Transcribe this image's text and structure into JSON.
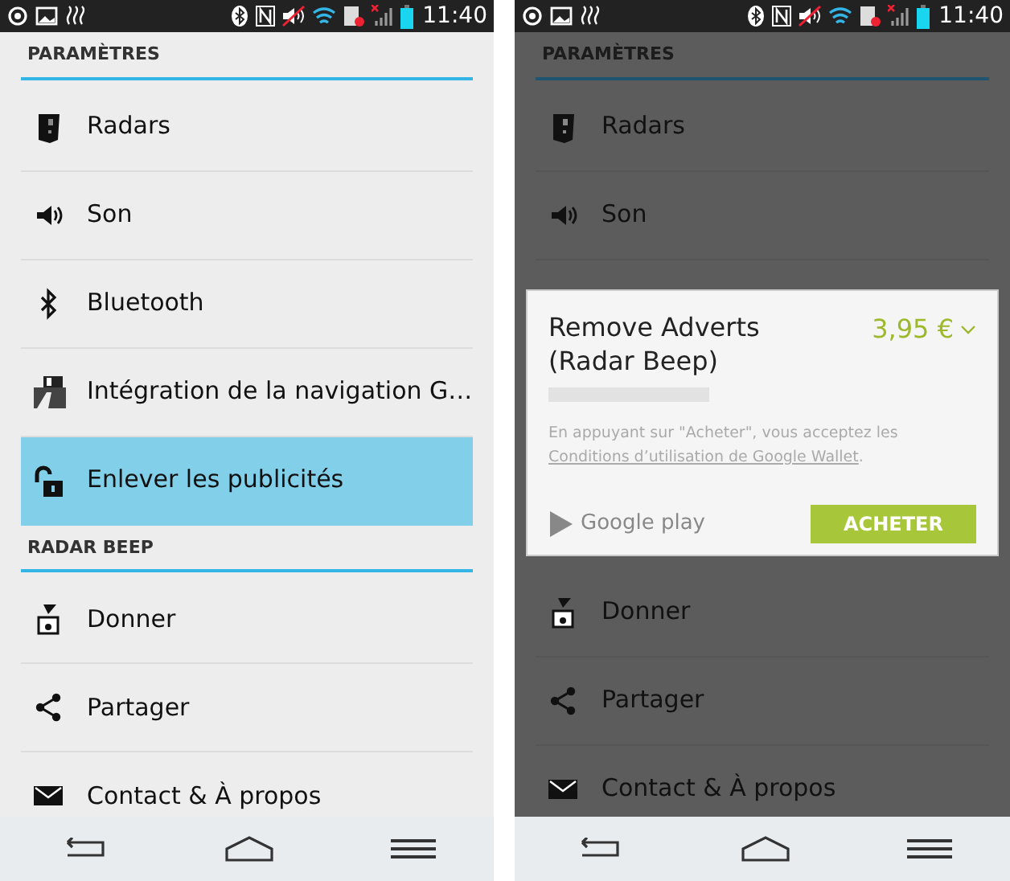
{
  "screens": [
    {
      "status_bar": {
        "time": "11:40"
      },
      "dimmed": false,
      "sections": [
        {
          "title": "PARAMÈTRES",
          "items": [
            {
              "label": "Radars",
              "kind": "radar",
              "selected": false
            },
            {
              "label": "Son",
              "kind": "sound",
              "selected": false
            },
            {
              "label": "Bluetooth",
              "kind": "bluetooth",
              "selected": false
            },
            {
              "label": "Intégration de la navigation G…",
              "kind": "navigation",
              "selected": false
            },
            {
              "label": "Enlever les publicités",
              "kind": "unlock",
              "selected": true
            }
          ]
        },
        {
          "title": "RADAR BEEP",
          "items": [
            {
              "label": "Donner",
              "kind": "donate",
              "selected": false
            },
            {
              "label": "Partager",
              "kind": "share",
              "selected": false
            },
            {
              "label": "Contact & À propos",
              "kind": "mail",
              "selected": false
            }
          ]
        }
      ]
    },
    {
      "status_bar": {
        "time": "11:40"
      },
      "dimmed": true,
      "sections": [
        {
          "title": "PARAMÈTRES",
          "items": [
            {
              "label": "Radars",
              "kind": "radar",
              "selected": false
            },
            {
              "label": "Son",
              "kind": "sound",
              "selected": false
            }
          ]
        },
        {
          "items": [
            {
              "label": "Donner",
              "kind": "donate",
              "selected": false
            },
            {
              "label": "Partager",
              "kind": "share",
              "selected": false
            },
            {
              "label": "Contact & À propos",
              "kind": "mail",
              "selected": false
            }
          ]
        }
      ],
      "dialog": {
        "title": "Remove Adverts (Radar Beep)",
        "price": "3,95 €",
        "terms": "En appuyant sur \"Acheter\", vous acceptez les",
        "terms_link": "Conditions d’utilisation de Google Wallet",
        "terms_end": ".",
        "store": "Google play",
        "button": "ACHETER"
      }
    }
  ]
}
